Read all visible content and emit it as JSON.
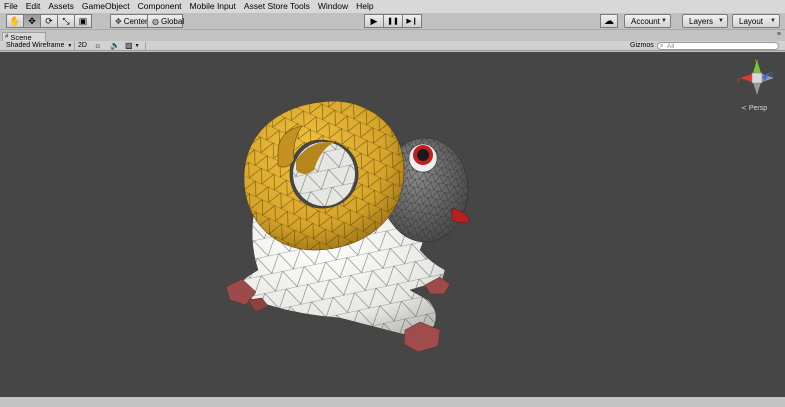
{
  "menu": [
    "File",
    "Edit",
    "Assets",
    "GameObject",
    "Component",
    "Mobile Input",
    "Asset Store Tools",
    "Window",
    "Help"
  ],
  "toolbar": {
    "tools": [
      {
        "name": "hand-tool",
        "glyph": "✋"
      },
      {
        "name": "move-tool",
        "glyph": "✥"
      },
      {
        "name": "rotate-tool",
        "glyph": "⟳"
      },
      {
        "name": "scale-tool",
        "glyph": "⤡"
      },
      {
        "name": "rect-tool",
        "glyph": "▣"
      }
    ],
    "pivot_label": "Center",
    "space_label": "Global",
    "play_glyph": "▶",
    "pause_glyph": "❚❚",
    "step_glyph": "▶❙",
    "cloud_glyph": "☁",
    "account_label": "Account",
    "layers_label": "Layers",
    "layout_label": "Layout"
  },
  "scene": {
    "tab_label": "Scene",
    "shading_mode": "Shaded Wireframe",
    "mode_2d": "2D",
    "gizmos_label": "Gizmos",
    "search_placeholder": "All",
    "projection_label": "Persp"
  },
  "colors": {
    "viewport_bg": "#464646",
    "horn": "#d6a429",
    "wool": "#eeeeea",
    "head": "#6a6a6a",
    "hooves": "#9c4a4a",
    "gizmo_x": "#e0382d",
    "gizmo_y": "#79c537",
    "gizmo_z": "#3b6ed8"
  }
}
